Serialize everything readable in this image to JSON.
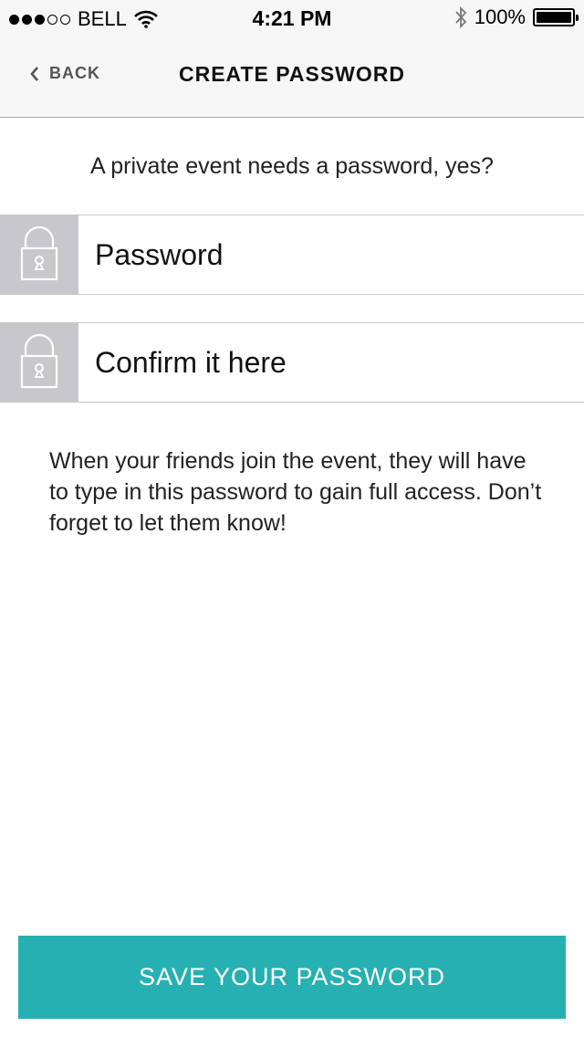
{
  "status_bar": {
    "signal_filled": 3,
    "signal_total": 5,
    "carrier": "BELL",
    "time": "4:21 PM",
    "battery_text": "100%",
    "battery_level": 1.0
  },
  "nav": {
    "back_label": "BACK",
    "title": "CREATE PASSWORD"
  },
  "intro_text": "A private event needs a password, yes?",
  "fields": {
    "password": {
      "value": "",
      "placeholder": "Password",
      "icon": "lock-icon"
    },
    "confirm": {
      "value": "",
      "placeholder": "Confirm it here",
      "icon": "lock-icon"
    }
  },
  "info_text": "When your friends join the event, they will have to type in this password to gain full access. Don’t forget to let them know!",
  "save_button_label": "SAVE YOUR PASSWORD",
  "colors": {
    "accent": "#26b0b2",
    "bar_background": "#f6f6f6",
    "icon_tile": "#c7c7cc"
  }
}
